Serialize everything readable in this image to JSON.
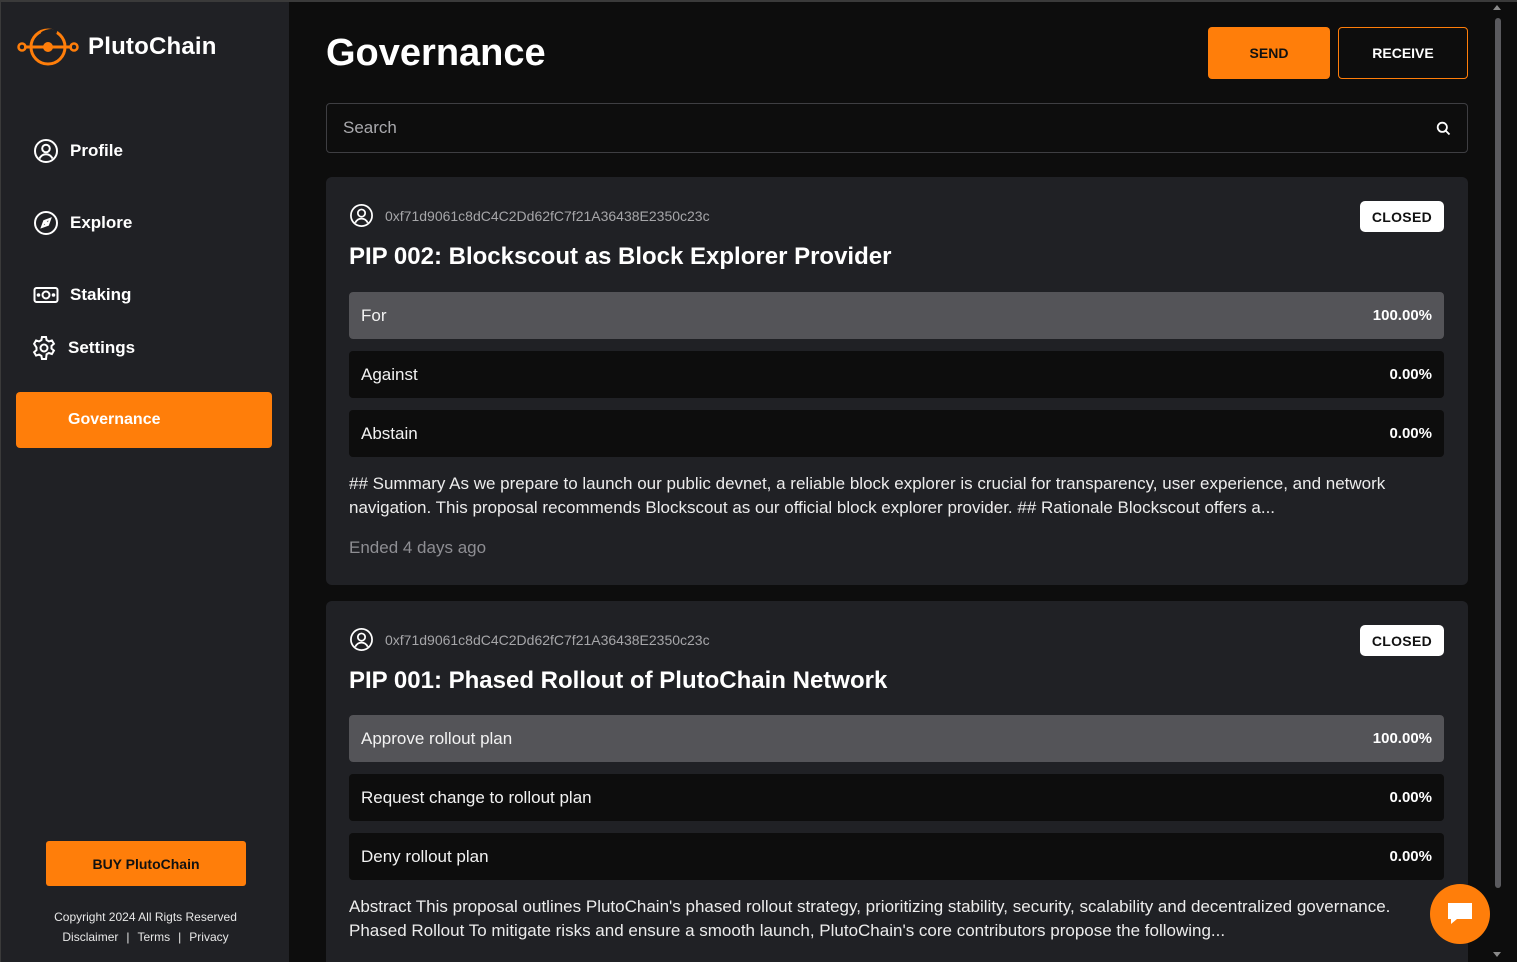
{
  "brand": {
    "name": "PlutoChain",
    "accent": "#ff7e0a"
  },
  "sidebar": {
    "items": [
      {
        "label": "Profile",
        "icon": "user-circle-icon"
      },
      {
        "label": "Explore",
        "icon": "compass-icon"
      },
      {
        "label": "Staking",
        "icon": "cash-icon"
      },
      {
        "label": "Settings",
        "icon": "gear-icon"
      }
    ],
    "active": {
      "label": "Governance"
    },
    "buy_label": "BUY PlutoChain",
    "copyright": "Copyright 2024 All Rigts Reserved",
    "links": [
      "Disclaimer",
      "Terms",
      "Privacy"
    ]
  },
  "header": {
    "title": "Governance",
    "send_label": "SEND",
    "receive_label": "RECEIVE"
  },
  "search": {
    "placeholder": "Search",
    "value": ""
  },
  "proposals": [
    {
      "author": "0xf71d9061c8dC4C2Dd62fC7f21A36438E2350c23c",
      "status": "CLOSED",
      "title": "PIP 002: Blockscout as Block Explorer Provider",
      "options": [
        {
          "label": "For",
          "pct_text": "100.00%",
          "pct": 100
        },
        {
          "label": "Against",
          "pct_text": "0.00%",
          "pct": 0
        },
        {
          "label": "Abstain",
          "pct_text": "0.00%",
          "pct": 0
        }
      ],
      "summary": "## Summary As we prepare to launch our public devnet, a reliable block explorer is crucial for transparency, user experience, and network navigation. This proposal recommends Blockscout as our official block explorer provider. ## Rationale Blockscout offers a...",
      "ended": "Ended 4 days ago"
    },
    {
      "author": "0xf71d9061c8dC4C2Dd62fC7f21A36438E2350c23c",
      "status": "CLOSED",
      "title": "PIP 001: Phased Rollout of PlutoChain Network",
      "options": [
        {
          "label": "Approve rollout plan",
          "pct_text": "100.00%",
          "pct": 100
        },
        {
          "label": "Request change to rollout plan",
          "pct_text": "0.00%",
          "pct": 0
        },
        {
          "label": "Deny rollout plan",
          "pct_text": "0.00%",
          "pct": 0
        }
      ],
      "summary": "Abstract This proposal outlines PlutoChain's phased rollout strategy, prioritizing stability, security, scalability and decentralized governance. Phased Rollout To mitigate risks and ensure a smooth launch, PlutoChain's core contributors propose the following..."
    }
  ]
}
